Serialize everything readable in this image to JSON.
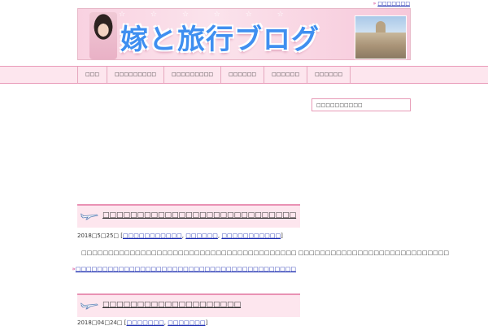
{
  "header": {
    "sitemap_bullet": "»",
    "sitemap_link": "□□□□□□□",
    "site_title": "嫁と旅行ブログ",
    "banner_stars": "☆ ☆ ☆ ☆ ☆ ☆"
  },
  "nav": {
    "items": [
      {
        "label": "□□□"
      },
      {
        "label": "□□□□□□□□□"
      },
      {
        "label": "□□□□□□□□□"
      },
      {
        "label": "□□□□□□"
      },
      {
        "label": "□□□□□□"
      },
      {
        "label": "□□□□□□"
      }
    ]
  },
  "sidebar": {
    "box_label": "□□□□□□□□□□"
  },
  "posts": [
    {
      "title": "□□□□□□□□□□□□□□□□□□□□□□□□□□□□",
      "date": "2018□5□25□",
      "cat_open": "[",
      "cat1": "□□□□□□□□□□□",
      "cat2": "□□□□□□",
      "cat3": "□□□□□□□□□□□",
      "cat_close": "]",
      "excerpt": "□□□□□□□□□□□□□□□□□□□□□□□□□□□□□□□□□□□□□□□□ □□□□□□□□□□□□□□□□□□□□□□□□□□□□",
      "more_bullet": "»",
      "more_link": "□□□□□□□□□□□□□□□□□□□□□□□□□□□□□□□□□□□□□□□□□"
    },
    {
      "title": "□□□□□□□□□□□□□□□□□□□□",
      "date": "2018□04□24□",
      "cat_open": "[",
      "cat1": "□□□□□□□",
      "cat2": "□□□□□□□",
      "cat_close": "]"
    }
  ]
}
